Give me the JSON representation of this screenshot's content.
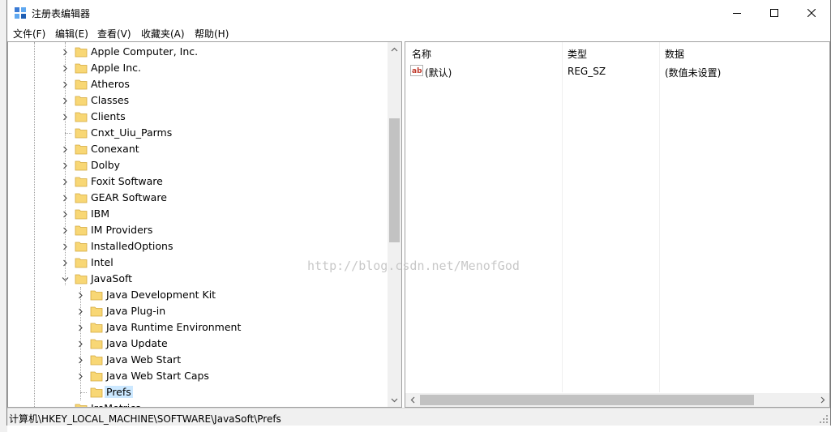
{
  "window": {
    "title": "注册表编辑器",
    "menu": [
      "文件(F)",
      "编辑(E)",
      "查看(V)",
      "收藏夹(A)",
      "帮助(H)"
    ]
  },
  "tree": {
    "nodes": [
      {
        "label": "Apple Computer, Inc.",
        "level": 1,
        "expander": "collapsed"
      },
      {
        "label": "Apple Inc.",
        "level": 1,
        "expander": "collapsed"
      },
      {
        "label": "Atheros",
        "level": 1,
        "expander": "collapsed"
      },
      {
        "label": "Classes",
        "level": 1,
        "expander": "collapsed"
      },
      {
        "label": "Clients",
        "level": 1,
        "expander": "collapsed"
      },
      {
        "label": "Cnxt_Uiu_Parms",
        "level": 1,
        "expander": "none"
      },
      {
        "label": "Conexant",
        "level": 1,
        "expander": "collapsed"
      },
      {
        "label": "Dolby",
        "level": 1,
        "expander": "collapsed"
      },
      {
        "label": "Foxit Software",
        "level": 1,
        "expander": "collapsed"
      },
      {
        "label": "GEAR Software",
        "level": 1,
        "expander": "collapsed"
      },
      {
        "label": "IBM",
        "level": 1,
        "expander": "collapsed"
      },
      {
        "label": "IM Providers",
        "level": 1,
        "expander": "collapsed"
      },
      {
        "label": "InstalledOptions",
        "level": 1,
        "expander": "collapsed"
      },
      {
        "label": "Intel",
        "level": 1,
        "expander": "collapsed"
      },
      {
        "label": "JavaSoft",
        "level": 1,
        "expander": "expanded"
      },
      {
        "label": "Java Development Kit",
        "level": 2,
        "expander": "collapsed"
      },
      {
        "label": "Java Plug-in",
        "level": 2,
        "expander": "collapsed"
      },
      {
        "label": "Java Runtime Environment",
        "level": 2,
        "expander": "collapsed"
      },
      {
        "label": "Java Update",
        "level": 2,
        "expander": "collapsed"
      },
      {
        "label": "Java Web Start",
        "level": 2,
        "expander": "collapsed"
      },
      {
        "label": "Java Web Start Caps",
        "level": 2,
        "expander": "collapsed"
      },
      {
        "label": "Prefs",
        "level": 2,
        "expander": "none",
        "selected": true
      },
      {
        "label": "JreMetrics",
        "level": 1,
        "expander": "none"
      }
    ]
  },
  "list": {
    "columns": [
      "名称",
      "类型",
      "数据"
    ],
    "rows": [
      {
        "name": "(默认)",
        "type": "REG_SZ",
        "data": "(数值未设置)",
        "icon": "string-value-icon"
      }
    ]
  },
  "watermark": "http://blog.csdn.net/MenofGod",
  "status": {
    "path": "计算机\\HKEY_LOCAL_MACHINE\\SOFTWARE\\JavaSoft\\Prefs"
  },
  "colors": {
    "folder": "#f8d775",
    "selection": "#cce8ff",
    "scroll_thumb": "#c2c2c2"
  }
}
